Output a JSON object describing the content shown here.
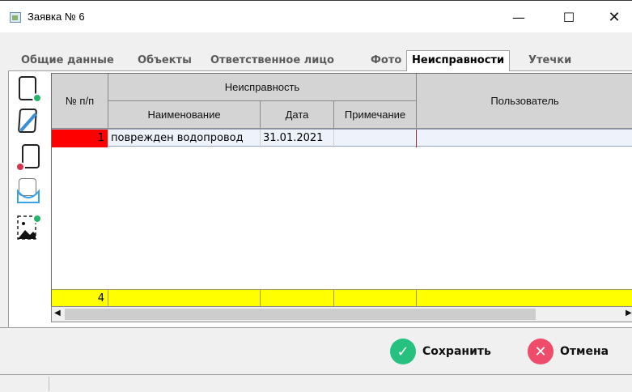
{
  "window": {
    "title": "Заявка № 6",
    "minimize": "—",
    "maximize": "☐",
    "close": "✕"
  },
  "tabs": [
    {
      "label": "Общие данные",
      "active": false
    },
    {
      "label": "Объекты",
      "active": false
    },
    {
      "label": "Ответственное лицо",
      "active": false
    },
    {
      "label": "Фото",
      "active": false
    },
    {
      "label": "Неисправности",
      "active": true
    },
    {
      "label": "Утечки",
      "active": false
    }
  ],
  "toolbar": {
    "icons": [
      "add-document-icon",
      "edit-document-icon",
      "delete-document-icon",
      "document-mail-icon",
      "add-image-icon"
    ]
  },
  "grid": {
    "headers": {
      "num": "№ п/п",
      "group": "Неисправность",
      "name": "Наименование",
      "date": "Дата",
      "note": "Примечание",
      "user": "Пользователь"
    },
    "rows": [
      {
        "num": "1",
        "name": "поврежден водопровод",
        "date": "31.01.2021",
        "note": "",
        "user": ""
      }
    ],
    "footer": {
      "count": "4"
    }
  },
  "actions": {
    "save": "Сохранить",
    "cancel": "Отмена"
  },
  "colors": {
    "num_cell_highlight": "#ff0000",
    "footer_row": "#ffff00",
    "save": "#27c17f",
    "cancel": "#ef4c6b"
  }
}
